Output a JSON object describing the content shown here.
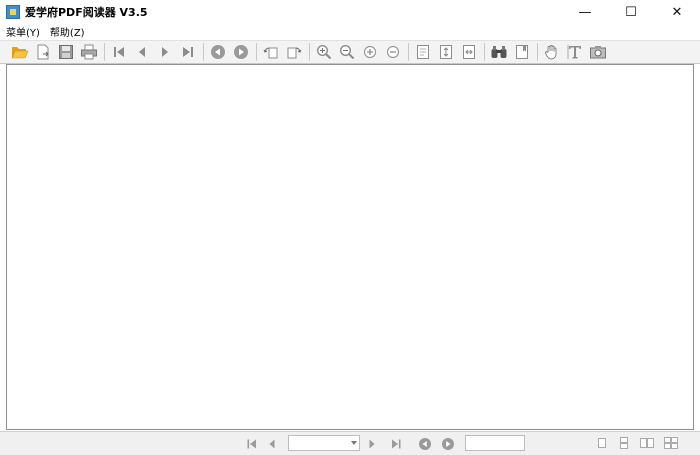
{
  "window": {
    "title": "爱学府PDF阅读器 V3.5",
    "controls": {
      "minimize": "—",
      "maximize": "☐",
      "close": "✕"
    }
  },
  "menu": {
    "items": [
      {
        "label": "菜单(Y)"
      },
      {
        "label": "帮助(Z)"
      }
    ]
  },
  "statusbar": {
    "page_value": "",
    "zoom_value": ""
  },
  "colors": {
    "toolbar_bg": "#f3f3f3",
    "icon_gray": "#8c8c8c",
    "folder_yellow": "#f0b428"
  }
}
